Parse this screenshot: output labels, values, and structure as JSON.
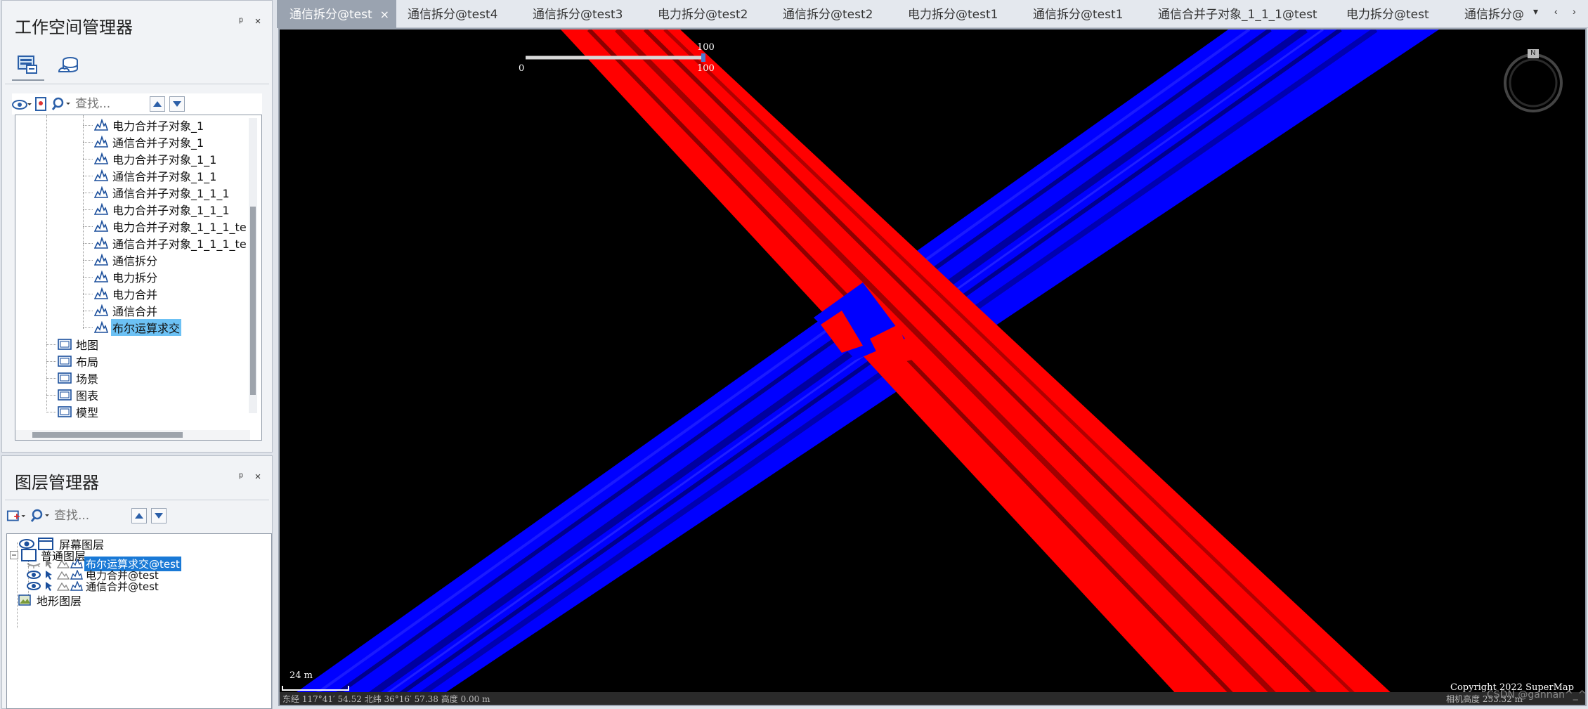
{
  "workspace_panel": {
    "title": "工作空间管理器",
    "pin": "ᵖ",
    "close": "×",
    "search_placeholder": "查找...",
    "tree_items": [
      {
        "label": "电力合并子对象_1",
        "level": 3
      },
      {
        "label": "通信合并子对象_1",
        "level": 3
      },
      {
        "label": "电力合并子对象_1_1",
        "level": 3
      },
      {
        "label": "通信合并子对象_1_1",
        "level": 3
      },
      {
        "label": "通信合并子对象_1_1_1",
        "level": 3
      },
      {
        "label": "电力合并子对象_1_1_1",
        "level": 3
      },
      {
        "label": "电力合并子对象_1_1_1_te",
        "level": 3
      },
      {
        "label": "通信合并子对象_1_1_1_te",
        "level": 3
      },
      {
        "label": "通信拆分",
        "level": 3
      },
      {
        "label": "电力拆分",
        "level": 3
      },
      {
        "label": "电力合并",
        "level": 3
      },
      {
        "label": "通信合并",
        "level": 3
      },
      {
        "label": "布尔运算求交",
        "level": 3,
        "selected": true
      },
      {
        "label": "地图",
        "level": 1,
        "icon": "map-icon"
      },
      {
        "label": "布局",
        "level": 1,
        "icon": "layout-icon"
      },
      {
        "label": "场景",
        "level": 1,
        "icon": "scene-icon"
      },
      {
        "label": "图表",
        "level": 1,
        "icon": "chart-icon"
      },
      {
        "label": "模型",
        "level": 1,
        "icon": "model-icon"
      }
    ]
  },
  "layer_panel": {
    "title": "图层管理器",
    "pin": "ᵖ",
    "close": "×",
    "search_placeholder": "查找...",
    "screen_layer": "屏幕图层",
    "normal_layer": "普通图层",
    "layers": [
      {
        "label": "布尔运算求交@test",
        "visible": false,
        "selected": true
      },
      {
        "label": "电力合并@test",
        "visible": true,
        "selected": false
      },
      {
        "label": "通信合并@test",
        "visible": true,
        "selected": false
      }
    ],
    "terrain_layer": "地形图层"
  },
  "tabs": [
    {
      "label": "通信拆分@test",
      "active": true
    },
    {
      "label": "通信拆分@test4"
    },
    {
      "label": "通信拆分@test3"
    },
    {
      "label": "电力拆分@test2"
    },
    {
      "label": "通信拆分@test2"
    },
    {
      "label": "电力拆分@test1"
    },
    {
      "label": "通信拆分@test1"
    },
    {
      "label": "通信合并子对象_1_1_1@test"
    },
    {
      "label": "电力拆分@test"
    },
    {
      "label": "通信拆分@"
    }
  ],
  "tab_close": "×",
  "tab_nav": [
    "▾",
    "‹",
    "›"
  ],
  "scene": {
    "slider_min": "0",
    "slider_max_top": "100",
    "slider_max": "100",
    "compass_label": "N",
    "scale_label": "24 m",
    "copyright": "Copyright 2022 SuperMap",
    "watermark": "CSDN @gannan^_^",
    "status_text": "东经 117°41′  54.52  北纬 36°16′  57.38  高度 0.00 m",
    "camera_text": "相机高度 253.32 m",
    "colors": {
      "red": "#ff0000",
      "blue": "#0000ff",
      "background": "#000000"
    }
  }
}
